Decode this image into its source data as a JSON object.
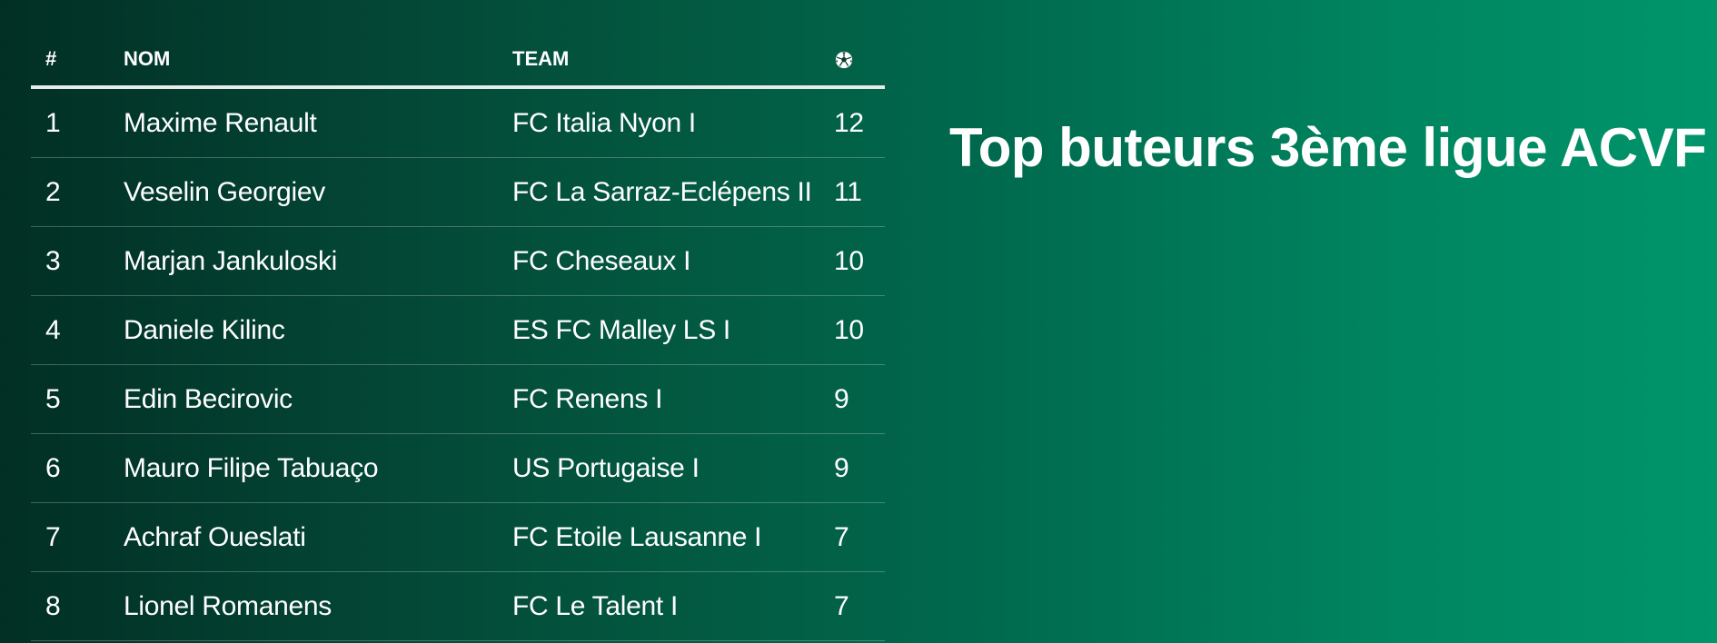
{
  "title": "Top buteurs 3ème ligue ACVF",
  "table": {
    "headers": {
      "rank": "#",
      "name": "NOM",
      "team": "TEAM",
      "goals_icon": "soccer-ball-icon"
    },
    "rows": [
      {
        "rank": "1",
        "name": "Maxime Renault",
        "team": "FC Italia Nyon I",
        "goals": "12"
      },
      {
        "rank": "2",
        "name": "Veselin Georgiev",
        "team": "FC La Sarraz-Eclépens II",
        "goals": "11"
      },
      {
        "rank": "3",
        "name": "Marjan Jankuloski",
        "team": "FC Cheseaux I",
        "goals": "10"
      },
      {
        "rank": "4",
        "name": "Daniele Kilinc",
        "team": "ES FC Malley LS I",
        "goals": "10"
      },
      {
        "rank": "5",
        "name": "Edin Becirovic",
        "team": "FC Renens I",
        "goals": "9"
      },
      {
        "rank": "6",
        "name": "Mauro Filipe Tabuaço",
        "team": "US Portugaise I",
        "goals": "9"
      },
      {
        "rank": "7",
        "name": "Achraf Oueslati",
        "team": "FC Etoile Lausanne I",
        "goals": "7"
      },
      {
        "rank": "8",
        "name": "Lionel Romanens",
        "team": "FC Le Talent I",
        "goals": "7"
      }
    ]
  },
  "colors": {
    "background_start": "#022f24",
    "background_end": "#00956b",
    "text": "#ffffff"
  }
}
